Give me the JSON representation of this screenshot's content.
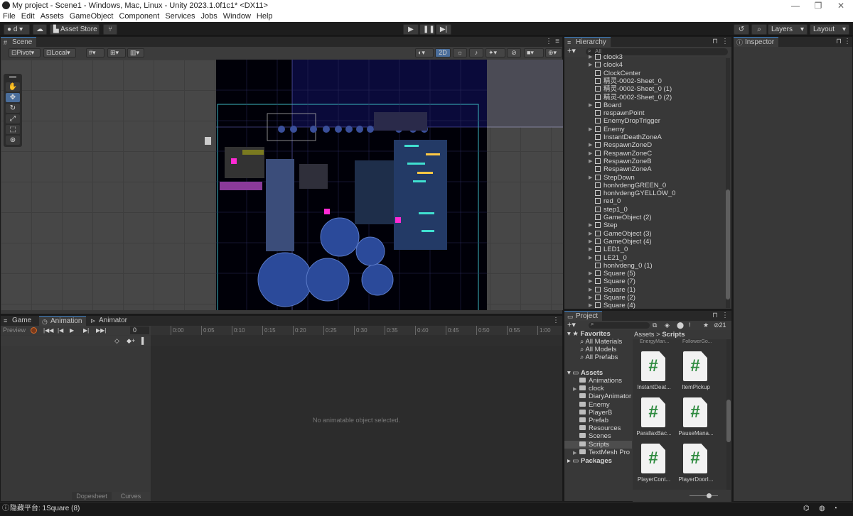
{
  "titlebar": {
    "text": "My project - Scene1 - Windows, Mac, Linux - Unity 2023.1.0f1c1* <DX11>",
    "min": "—",
    "max": "❐",
    "close": "✕"
  },
  "menu": [
    "File",
    "Edit",
    "Assets",
    "GameObject",
    "Component",
    "Services",
    "Jobs",
    "Window",
    "Help"
  ],
  "toolbar": {
    "account": "d",
    "asset_store": "Asset Store",
    "layers": "Layers",
    "layout": "Layout"
  },
  "scene": {
    "tab": "Scene",
    "pivot": "Pivot",
    "local": "Local",
    "mode_2d": "2D"
  },
  "hierarchy": {
    "tab": "Hierarchy",
    "search_placeholder": "All",
    "items": [
      {
        "label": "clock3",
        "arrow": true
      },
      {
        "label": "clock4",
        "arrow": true
      },
      {
        "label": "ClockCenter",
        "arrow": false
      },
      {
        "label": "精灵-0002-Sheet_0",
        "arrow": false
      },
      {
        "label": "精灵-0002-Sheet_0 (1)",
        "arrow": false
      },
      {
        "label": "精灵-0002-Sheet_0 (2)",
        "arrow": false
      },
      {
        "label": "Board",
        "arrow": true
      },
      {
        "label": "respawnPoint",
        "arrow": false
      },
      {
        "label": "EnemyDropTrigger",
        "arrow": false
      },
      {
        "label": "Enemy",
        "arrow": true
      },
      {
        "label": "InstantDeathZoneA",
        "arrow": false
      },
      {
        "label": "RespawnZoneD",
        "arrow": true
      },
      {
        "label": "RespawnZoneC",
        "arrow": true
      },
      {
        "label": "RespawnZoneB",
        "arrow": true
      },
      {
        "label": "RespawnZoneA",
        "arrow": false
      },
      {
        "label": "StepDown",
        "arrow": true
      },
      {
        "label": "honlvdengGREEN_0",
        "arrow": false
      },
      {
        "label": "honlvdengGYELLOW_0",
        "arrow": false
      },
      {
        "label": "red_0",
        "arrow": false
      },
      {
        "label": "step1_0",
        "arrow": false
      },
      {
        "label": "GameObject (2)",
        "arrow": false
      },
      {
        "label": "Step",
        "arrow": true
      },
      {
        "label": "GameObject (3)",
        "arrow": true
      },
      {
        "label": "GameObject (4)",
        "arrow": true
      },
      {
        "label": "LED1_0",
        "arrow": true
      },
      {
        "label": "LE21_0",
        "arrow": true
      },
      {
        "label": "honlvdeng_0 (1)",
        "arrow": false
      },
      {
        "label": "Square (5)",
        "arrow": true
      },
      {
        "label": "Square (7)",
        "arrow": true
      },
      {
        "label": "Square (1)",
        "arrow": true
      },
      {
        "label": "Square (2)",
        "arrow": true
      },
      {
        "label": "Square (4)",
        "arrow": true
      }
    ]
  },
  "inspector": {
    "tab": "Inspector"
  },
  "bottom": {
    "tabs": [
      "Game",
      "Animation",
      "Animator"
    ],
    "preview": "Preview",
    "frame": "0",
    "ruler": [
      "0:00",
      "0:05",
      "0:10",
      "0:15",
      "0:20",
      "0:25",
      "0:30",
      "0:35",
      "0:40",
      "0:45",
      "0:50",
      "0:55",
      "1:00"
    ],
    "empty": "No animatable object selected.",
    "dopesheet": "Dopesheet",
    "curves": "Curves"
  },
  "project": {
    "tab": "Project",
    "count": "21",
    "breadcrumb": [
      "Assets",
      "Scripts"
    ],
    "favorites_label": "Favorites",
    "favorites": [
      "All Materials",
      "All Models",
      "All Prefabs"
    ],
    "assets_label": "Assets",
    "folders": [
      {
        "label": "Animations",
        "arrow": false
      },
      {
        "label": "clock",
        "arrow": true
      },
      {
        "label": "DiaryAnimator",
        "arrow": false
      },
      {
        "label": "Enemy",
        "arrow": false
      },
      {
        "label": "PlayerB",
        "arrow": false
      },
      {
        "label": "Prefab",
        "arrow": false
      },
      {
        "label": "Resources",
        "arrow": false
      },
      {
        "label": "Scenes",
        "arrow": false
      },
      {
        "label": "Scripts",
        "arrow": false,
        "selected": true
      },
      {
        "label": "TextMesh Pro",
        "arrow": true
      }
    ],
    "packages_label": "Packages",
    "top_partial": [
      "EnergyMan...",
      "FollowerGo..."
    ],
    "files": [
      "InstantDeat...",
      "ItemPickup",
      "ParallaxBac...",
      "PauseMana...",
      "PlayerCont...",
      "PlayerDoorI..."
    ],
    "script_glyph": "#"
  },
  "status": {
    "text": "隐藏平台: 1Square (8)"
  }
}
